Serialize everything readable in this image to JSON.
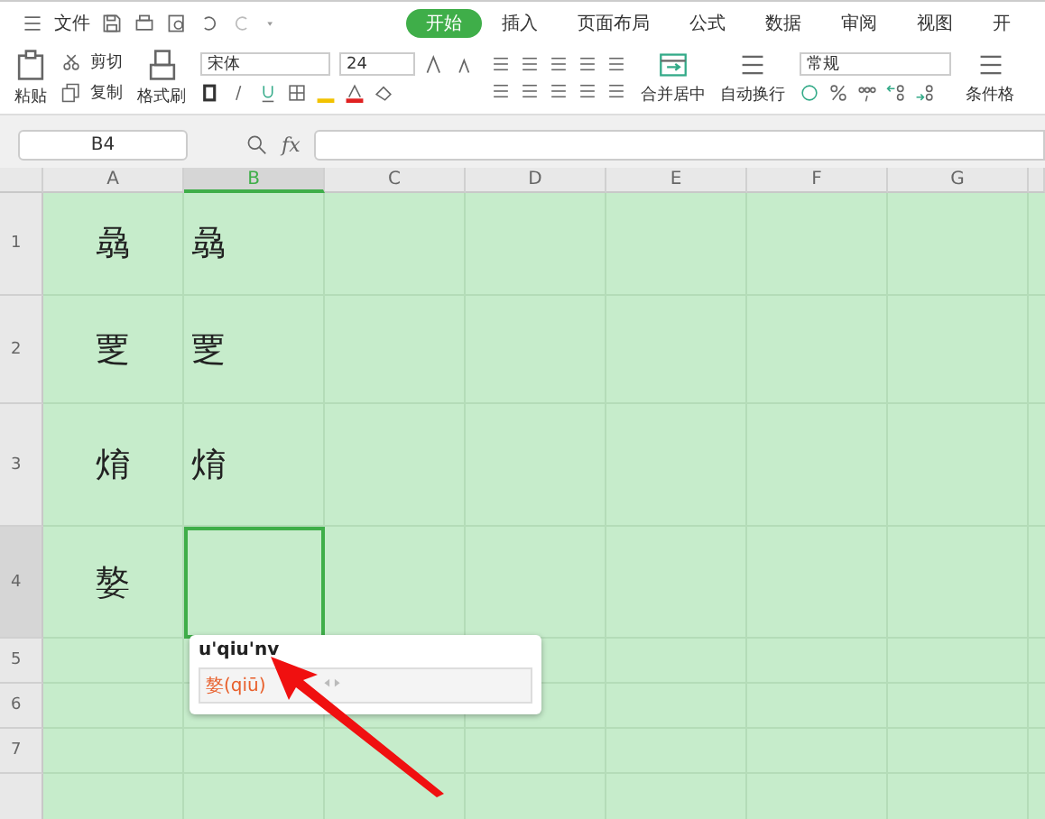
{
  "menu": {
    "file": "文件"
  },
  "tabs": [
    {
      "label": "开始",
      "selected": true
    },
    {
      "label": "插入",
      "selected": false
    },
    {
      "label": "页面布局",
      "selected": false
    },
    {
      "label": "公式",
      "selected": false
    },
    {
      "label": "数据",
      "selected": false
    },
    {
      "label": "审阅",
      "selected": false
    },
    {
      "label": "视图",
      "selected": false
    },
    {
      "label": "开",
      "selected": false
    }
  ],
  "ribbon": {
    "paste": "粘贴",
    "cut": "剪切",
    "copy": "复制",
    "format_painter": "格式刷",
    "font": "宋体",
    "font_size": "24",
    "merge": "合并居中",
    "wrap": "自动换行",
    "number_format": "常规",
    "conditional": "条件格"
  },
  "formula_bar": {
    "cell_ref": "B4",
    "fx_label": "fx"
  },
  "columns": [
    {
      "label": "A",
      "selected": false
    },
    {
      "label": "B",
      "selected": true
    },
    {
      "label": "C",
      "selected": false
    },
    {
      "label": "D",
      "selected": false
    },
    {
      "label": "E",
      "selected": false
    },
    {
      "label": "F",
      "selected": false
    },
    {
      "label": "G",
      "selected": false
    }
  ],
  "rows": [
    {
      "label": "1",
      "selected": false,
      "cells": [
        {
          "text": "骉",
          "selected": false
        },
        {
          "text": "骉",
          "selected": false
        }
      ]
    },
    {
      "label": "2",
      "selected": false,
      "cells": [
        {
          "text": "覂",
          "selected": false
        },
        {
          "text": "覂",
          "selected": false
        }
      ]
    },
    {
      "label": "3",
      "selected": false,
      "cells": [
        {
          "text": "焴",
          "selected": false
        },
        {
          "text": "焴",
          "selected": false
        }
      ]
    },
    {
      "label": "4",
      "selected": true,
      "cells": [
        {
          "text": "嫯",
          "selected": false
        },
        {
          "selected": true
        }
      ]
    },
    {
      "label": "5",
      "selected": false,
      "cells": []
    },
    {
      "label": "6",
      "selected": false,
      "cells": []
    },
    {
      "label": "7",
      "selected": false,
      "cells": []
    }
  ],
  "ime": {
    "input": "u'qiu'nv",
    "candidate": "嫯(qiū)"
  }
}
